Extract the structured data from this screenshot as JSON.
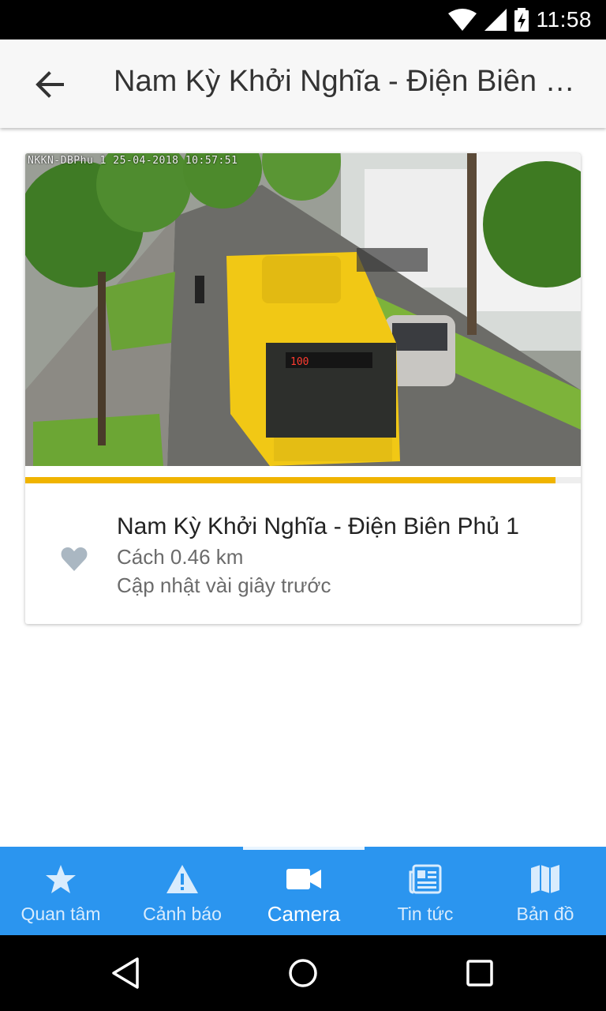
{
  "status_bar": {
    "time": "11:58",
    "icons": [
      "wifi-icon",
      "signal-icon",
      "battery-charging-icon"
    ]
  },
  "app_bar": {
    "back_icon": "arrow-left-icon",
    "title": "Nam Kỳ Khởi Nghĩa - Điện Biên Phủ 1"
  },
  "camera_card": {
    "overlay_text": "NKKN-DBPhu 1 25-04-2018 10:57:51",
    "image_subject": "traffic-camera-street-with-yellow-bus",
    "refresh_progress": 0.955,
    "progress_color": "#f0b400",
    "favorite_icon": "heart-icon",
    "name": "Nam Kỳ Khởi Nghĩa - Điện Biên Phủ 1",
    "distance": "Cách 0.46 km",
    "updated": "Cập nhật vài giây trước"
  },
  "bottom_nav": {
    "background": "#2b95ef",
    "active_index": 2,
    "items": [
      {
        "label": "Quan tâm",
        "icon": "star-icon"
      },
      {
        "label": "Cảnh báo",
        "icon": "warning-icon"
      },
      {
        "label": "Camera",
        "icon": "video-camera-icon"
      },
      {
        "label": "Tin tức",
        "icon": "newspaper-icon"
      },
      {
        "label": "Bản đồ",
        "icon": "map-icon"
      }
    ]
  },
  "system_nav": {
    "back": "back-triangle-icon",
    "home": "home-circle-icon",
    "recents": "recents-square-icon"
  }
}
